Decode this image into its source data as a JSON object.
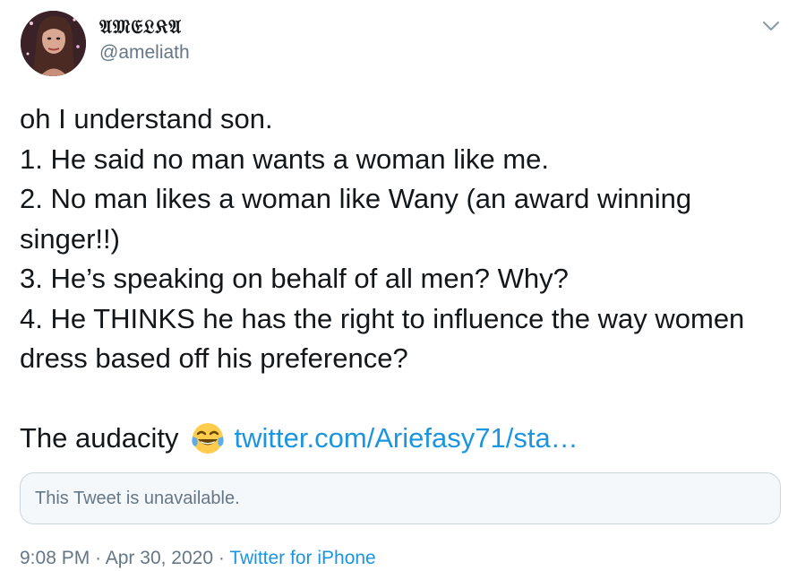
{
  "author": {
    "display_name": "𝔄𝔐𝔈𝔏𝔎𝔄",
    "handle": "@ameliath"
  },
  "tweet": {
    "body": "oh I understand son.\n1. He said no man wants a woman like me.\n2. No man likes a woman like Wany (an award winning singer!!)\n3. He’s speaking on behalf of all men? Why?\n4. He THINKS he has the right to influence the way women dress based off his preference?",
    "closing_text": "The audacity",
    "emoji_icon": "face-with-tears-of-joy-icon",
    "link_text": "twitter.com/Ariefasy71/sta…"
  },
  "quoted_tweet": {
    "message": "This Tweet is unavailable."
  },
  "meta": {
    "time": "9:08 PM",
    "separator": "·",
    "date": "Apr 30, 2020",
    "source": "Twitter for iPhone"
  },
  "colors": {
    "link": "#1b95e0",
    "secondary_text": "#657786",
    "card_border": "#ccd6dd"
  }
}
